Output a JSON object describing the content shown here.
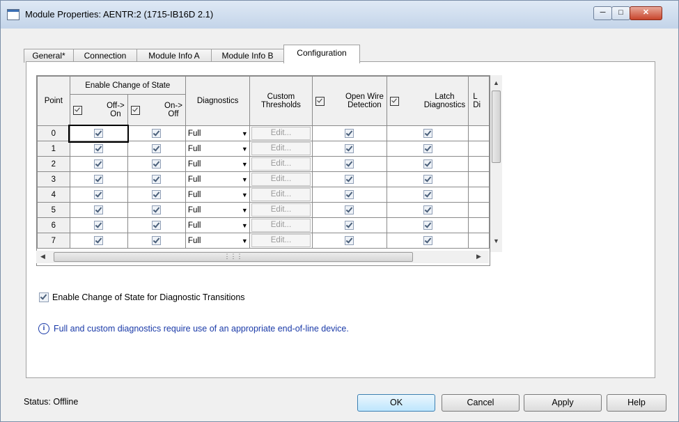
{
  "window": {
    "title": "Module Properties: AENTR:2 (1715-IB16D 2.1)",
    "minimize_icon": "minimize-icon",
    "maximize_icon": "maximize-icon",
    "close_icon": "close-icon"
  },
  "tabs": [
    {
      "label": "General*"
    },
    {
      "label": "Connection"
    },
    {
      "label": "Module Info A"
    },
    {
      "label": "Module Info B"
    },
    {
      "label": "Configuration"
    }
  ],
  "grid": {
    "headers": {
      "point": "Point",
      "enable_cos": "Enable Change of State",
      "off_on": "Off->\nOn",
      "off_on_top": "Off->",
      "off_on_bottom": "On",
      "on_off_top": "On->",
      "on_off_bottom": "Off",
      "diagnostics": "Diagnostics",
      "custom_top": "Custom",
      "custom_bottom": "Thresholds",
      "openwire_top": "Open Wire",
      "openwire_bottom": "Detection",
      "latch_top": "Latch",
      "latch_bottom": "Diagnostics",
      "partial_top": "L",
      "partial_bottom": "Di"
    },
    "rows": [
      {
        "point": "0",
        "off_on": true,
        "on_off": true,
        "diagnostics": "Full",
        "custom": "Edit...",
        "open_wire": true,
        "latch": true
      },
      {
        "point": "1",
        "off_on": true,
        "on_off": true,
        "diagnostics": "Full",
        "custom": "Edit...",
        "open_wire": true,
        "latch": true
      },
      {
        "point": "2",
        "off_on": true,
        "on_off": true,
        "diagnostics": "Full",
        "custom": "Edit...",
        "open_wire": true,
        "latch": true
      },
      {
        "point": "3",
        "off_on": true,
        "on_off": true,
        "diagnostics": "Full",
        "custom": "Edit...",
        "open_wire": true,
        "latch": true
      },
      {
        "point": "4",
        "off_on": true,
        "on_off": true,
        "diagnostics": "Full",
        "custom": "Edit...",
        "open_wire": true,
        "latch": true
      },
      {
        "point": "5",
        "off_on": true,
        "on_off": true,
        "diagnostics": "Full",
        "custom": "Edit...",
        "open_wire": true,
        "latch": true
      },
      {
        "point": "6",
        "off_on": true,
        "on_off": true,
        "diagnostics": "Full",
        "custom": "Edit...",
        "open_wire": true,
        "latch": true
      },
      {
        "point": "7",
        "off_on": true,
        "on_off": true,
        "diagnostics": "Full",
        "custom": "Edit...",
        "open_wire": true,
        "latch": true
      }
    ]
  },
  "options": {
    "cos_diag_label": "Enable Change of State for Diagnostic Transitions",
    "cos_diag_checked": true
  },
  "info": {
    "icon": "info-icon",
    "text": "Full and custom diagnostics require use of an appropriate end-of-line device."
  },
  "status": {
    "text": "Status:  Offline"
  },
  "buttons": {
    "ok": "OK",
    "cancel": "Cancel",
    "apply": "Apply",
    "help": "Help"
  }
}
